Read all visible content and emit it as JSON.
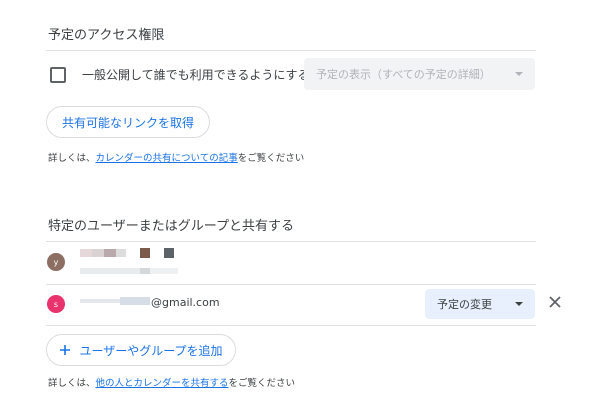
{
  "access_section": {
    "title": "予定のアクセス権限",
    "public_checkbox_label": "一般公開して誰でも利用できるようにする",
    "public_checked": false,
    "visibility_select_value": "予定の表示（すべての予定の詳細）",
    "share_link_button": "共有可能なリンクを取得",
    "help_prefix": "詳しくは、",
    "help_link": "カレンダーの共有についての記事",
    "help_suffix": "をご覧ください"
  },
  "share_section": {
    "title": "特定のユーザーまたはグループと共有する",
    "users": [
      {
        "avatar_letter": "y",
        "avatar_color": "#8d6e63",
        "name": "",
        "email": ""
      },
      {
        "avatar_letter": "s",
        "avatar_color": "#e8336d",
        "email": "@gmail.com",
        "permission": "予定の変更"
      }
    ],
    "add_button": "ユーザーやグループを追加",
    "add_button_icon": "plus-icon",
    "help_prefix": "詳しくは、",
    "help_link": "他の人とカレンダーを共有する",
    "help_suffix": "をご覧ください"
  },
  "colors": {
    "accent": "#1a73e8",
    "select_bg_active": "#e8f0fe",
    "select_bg_disabled": "#f1f3f4"
  }
}
